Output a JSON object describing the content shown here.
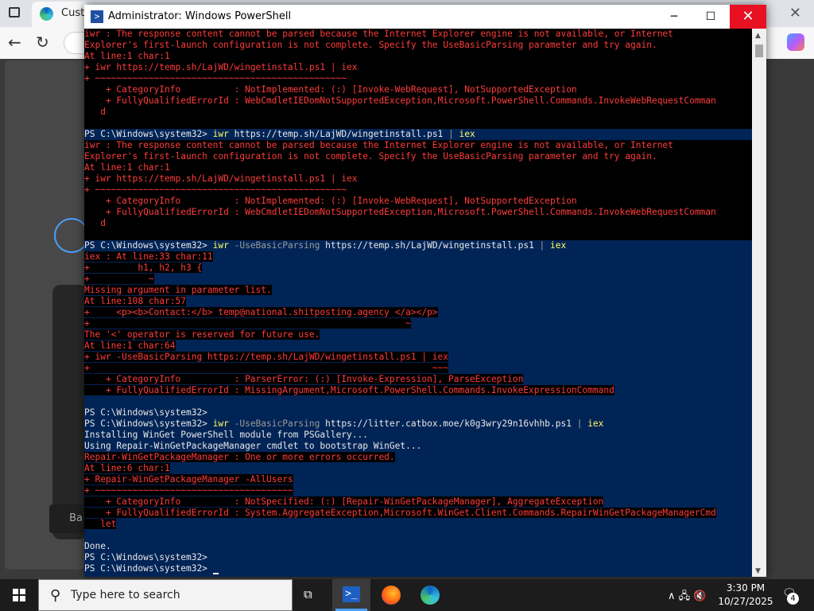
{
  "browser": {
    "tab_title": "Custo",
    "page_button": "Ba"
  },
  "window": {
    "title": "Administrator: Windows PowerShell",
    "minimize": "─",
    "maximize": "☐",
    "close": "✕"
  },
  "console": {
    "lines": [
      {
        "bg": "blk",
        "segs": [
          {
            "c": "err",
            "t": "iwr : The response content cannot be parsed because the Internet Explorer engine is not available, or Internet"
          }
        ]
      },
      {
        "bg": "blk",
        "segs": [
          {
            "c": "err",
            "t": "Explorer's first-launch configuration is not complete. Specify the UseBasicParsing parameter and try again."
          }
        ]
      },
      {
        "bg": "blk",
        "segs": [
          {
            "c": "err",
            "t": "At line:1 char:1"
          }
        ]
      },
      {
        "bg": "blk",
        "segs": [
          {
            "c": "err",
            "t": "+ iwr https://temp.sh/LajWD/wingetinstall.ps1 | iex"
          }
        ]
      },
      {
        "bg": "blk",
        "segs": [
          {
            "c": "err",
            "t": "+ ~~~~~~~~~~~~~~~~~~~~~~~~~~~~~~~~~~~~~~~~~~~~~~~"
          }
        ]
      },
      {
        "bg": "blk",
        "segs": [
          {
            "c": "err",
            "t": "    + CategoryInfo          : NotImplemented: (:) [Invoke-WebRequest], NotSupportedException"
          }
        ]
      },
      {
        "bg": "blk",
        "segs": [
          {
            "c": "err",
            "t": "    + FullyQualifiedErrorId : WebCmdletIEDomNotSupportedException,Microsoft.PowerShell.Commands.InvokeWebRequestComman"
          }
        ]
      },
      {
        "bg": "blk",
        "segs": [
          {
            "c": "err",
            "t": "   d"
          }
        ]
      },
      {
        "bg": "blk",
        "segs": [
          {
            "c": "w",
            "t": ""
          }
        ]
      },
      {
        "bg": "blu",
        "segs": [
          {
            "c": "w",
            "t": "PS C:\\Windows\\system32> "
          },
          {
            "c": "y",
            "t": "iwr"
          },
          {
            "c": "w",
            "t": " https://temp.sh/LajWD/wingetinstall.ps1 "
          },
          {
            "c": "g",
            "t": "|"
          },
          {
            "c": "y",
            "t": " iex"
          }
        ]
      },
      {
        "bg": "blk",
        "segs": [
          {
            "c": "err",
            "t": "iwr : The response content cannot be parsed because the Internet Explorer engine is not available, or Internet"
          }
        ]
      },
      {
        "bg": "blk",
        "segs": [
          {
            "c": "err",
            "t": "Explorer's first-launch configuration is not complete. Specify the UseBasicParsing parameter and try again."
          }
        ]
      },
      {
        "bg": "blk",
        "segs": [
          {
            "c": "err",
            "t": "At line:1 char:1"
          }
        ]
      },
      {
        "bg": "blk",
        "segs": [
          {
            "c": "err",
            "t": "+ iwr https://temp.sh/LajWD/wingetinstall.ps1 | iex"
          }
        ]
      },
      {
        "bg": "blk",
        "segs": [
          {
            "c": "err",
            "t": "+ ~~~~~~~~~~~~~~~~~~~~~~~~~~~~~~~~~~~~~~~~~~~~~~~"
          }
        ]
      },
      {
        "bg": "blk",
        "segs": [
          {
            "c": "err",
            "t": "    + CategoryInfo          : NotImplemented: (:) [Invoke-WebRequest], NotSupportedException"
          }
        ]
      },
      {
        "bg": "blk",
        "segs": [
          {
            "c": "err",
            "t": "    + FullyQualifiedErrorId : WebCmdletIEDomNotSupportedException,Microsoft.PowerShell.Commands.InvokeWebRequestComman"
          }
        ]
      },
      {
        "bg": "blk",
        "segs": [
          {
            "c": "err",
            "t": "   d"
          }
        ]
      },
      {
        "bg": "blk",
        "segs": [
          {
            "c": "w",
            "t": ""
          }
        ]
      },
      {
        "bg": "blu",
        "segs": [
          {
            "c": "w",
            "t": "PS C:\\Windows\\system32> "
          },
          {
            "c": "y",
            "t": "iwr"
          },
          {
            "c": "g",
            "t": " -UseBasicParsing"
          },
          {
            "c": "w",
            "t": " https://temp.sh/LajWD/wingetinstall.ps1 "
          },
          {
            "c": "g",
            "t": "|"
          },
          {
            "c": "y",
            "t": " iex"
          }
        ]
      },
      {
        "bg": "blu",
        "segs": [
          {
            "c": "errbg",
            "t": "iex : At line:33 char:11"
          }
        ]
      },
      {
        "bg": "blu",
        "segs": [
          {
            "c": "errbg",
            "t": "+         h1, h2, h3 {"
          }
        ]
      },
      {
        "bg": "blu",
        "segs": [
          {
            "c": "errbg",
            "t": "+           ~"
          }
        ]
      },
      {
        "bg": "blu",
        "segs": [
          {
            "c": "errbg",
            "t": "Missing argument in parameter list."
          }
        ]
      },
      {
        "bg": "blu",
        "segs": [
          {
            "c": "errbg",
            "t": "At line:108 char:57"
          }
        ]
      },
      {
        "bg": "blu",
        "segs": [
          {
            "c": "errbg",
            "t": "+     <p><b>Contact:</b> temp@national.shitposting.agency </a></p>"
          }
        ]
      },
      {
        "bg": "blu",
        "segs": [
          {
            "c": "errbg",
            "t": "+                                                           ~"
          }
        ]
      },
      {
        "bg": "blu",
        "segs": [
          {
            "c": "errbg",
            "t": "The '<' operator is reserved for future use."
          }
        ]
      },
      {
        "bg": "blu",
        "segs": [
          {
            "c": "errbg",
            "t": "At line:1 char:64"
          }
        ]
      },
      {
        "bg": "blu",
        "segs": [
          {
            "c": "errbg",
            "t": "+ iwr -UseBasicParsing https://temp.sh/LajWD/wingetinstall.ps1 | iex"
          }
        ]
      },
      {
        "bg": "blu",
        "segs": [
          {
            "c": "errbg",
            "t": "+                                                                ~~~"
          }
        ]
      },
      {
        "bg": "blu",
        "segs": [
          {
            "c": "errbg",
            "t": "    + CategoryInfo          : ParserError: (:) [Invoke-Expression], ParseException"
          }
        ]
      },
      {
        "bg": "blu",
        "segs": [
          {
            "c": "errbg",
            "t": "    + FullyQualifiedErrorId : MissingArgument,Microsoft.PowerShell.Commands.InvokeExpressionCommand"
          }
        ]
      },
      {
        "bg": "blu",
        "segs": [
          {
            "c": "w",
            "t": ""
          }
        ]
      },
      {
        "bg": "blu",
        "segs": [
          {
            "c": "w",
            "t": "PS C:\\Windows\\system32>"
          }
        ]
      },
      {
        "bg": "blu",
        "segs": [
          {
            "c": "w",
            "t": "PS C:\\Windows\\system32> "
          },
          {
            "c": "y",
            "t": "iwr"
          },
          {
            "c": "g",
            "t": " -UseBasicParsing"
          },
          {
            "c": "w",
            "t": " https://litter.catbox.moe/k0g3wry29n16vhhb.ps1 "
          },
          {
            "c": "g",
            "t": "|"
          },
          {
            "c": "y",
            "t": " iex"
          }
        ]
      },
      {
        "bg": "blu",
        "segs": [
          {
            "c": "w",
            "t": "Installing WinGet PowerShell module from PSGallery..."
          }
        ]
      },
      {
        "bg": "blu",
        "segs": [
          {
            "c": "w",
            "t": "Using Repair-WinGetPackageManager cmdlet to bootstrap WinGet..."
          }
        ]
      },
      {
        "bg": "blu",
        "segs": [
          {
            "c": "errbg",
            "t": "Repair-WinGetPackageManager : One or more errors occurred."
          }
        ]
      },
      {
        "bg": "blu",
        "segs": [
          {
            "c": "errbg",
            "t": "At line:6 char:1"
          }
        ]
      },
      {
        "bg": "blu",
        "segs": [
          {
            "c": "errbg",
            "t": "+ Repair-WinGetPackageManager -AllUsers"
          }
        ]
      },
      {
        "bg": "blu",
        "segs": [
          {
            "c": "errbg",
            "t": "+ ~~~~~~~~~~~~~~~~~~~~~~~~~~~~~~~~~~~~~"
          }
        ]
      },
      {
        "bg": "blu",
        "segs": [
          {
            "c": "errbg",
            "t": "    + CategoryInfo          : NotSpecified: (:) [Repair-WinGetPackageManager], AggregateException"
          }
        ]
      },
      {
        "bg": "blu",
        "segs": [
          {
            "c": "errbg",
            "t": "    + FullyQualifiedErrorId : System.AggregateException,Microsoft.WinGet.Client.Commands.RepairWinGetPackageManagerCmd"
          }
        ]
      },
      {
        "bg": "blu",
        "segs": [
          {
            "c": "errbg",
            "t": "   let"
          }
        ]
      },
      {
        "bg": "blu",
        "segs": [
          {
            "c": "w",
            "t": ""
          }
        ]
      },
      {
        "bg": "blu",
        "segs": [
          {
            "c": "w",
            "t": "Done."
          }
        ]
      },
      {
        "bg": "blu",
        "segs": [
          {
            "c": "w",
            "t": "PS C:\\Windows\\system32>"
          }
        ]
      },
      {
        "bg": "blu",
        "segs": [
          {
            "c": "w",
            "t": "PS C:\\Windows\\system32> "
          }
        ],
        "cursor": true
      }
    ]
  },
  "taskbar": {
    "search_placeholder": "Type here to search",
    "time": "3:30 PM",
    "date": "10/27/2025",
    "notification_count": "4",
    "tray_icons": "∧ 🖧 🔇"
  },
  "colors": {
    "console_bg": "#012456",
    "error_text": "#ff3b3b",
    "command_yellow": "#ffff66",
    "close_red": "#e81123"
  }
}
